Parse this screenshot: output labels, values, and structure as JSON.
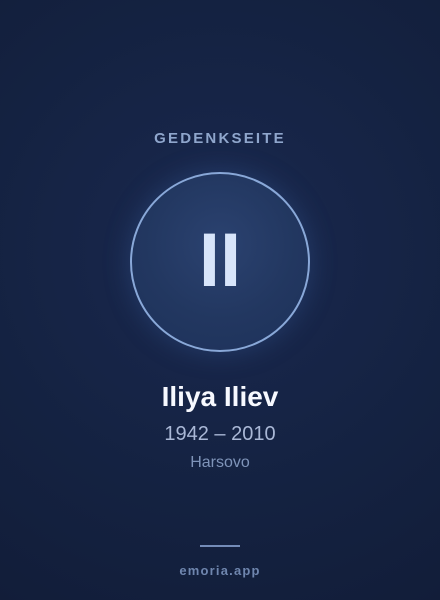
{
  "header": {
    "eyebrow": "GEDENKSEITE"
  },
  "profile": {
    "initials": "II",
    "name": "Iliya Iliev",
    "dates": "1942 – 2010",
    "place": "Harsovo"
  },
  "footer": {
    "site": "emoria.app"
  },
  "theme": {
    "background_top": "#121d39",
    "background_center": "#1a2b52",
    "ring_color": "#89a8d8",
    "text_primary": "#f7f9ff",
    "text_secondary": "#aab8d6",
    "text_muted": "#7f94b9"
  }
}
